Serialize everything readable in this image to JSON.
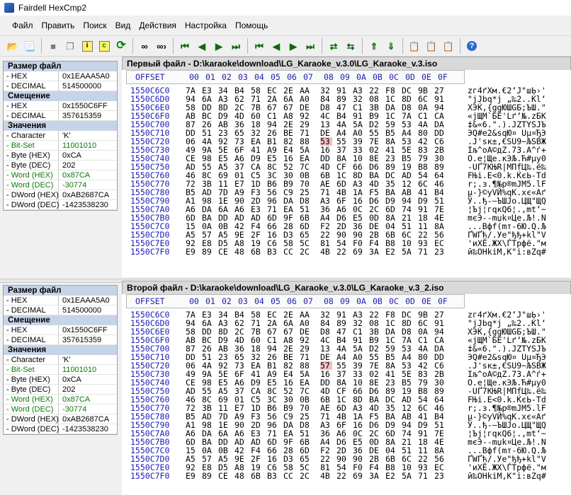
{
  "app": {
    "title": "Fairdell HexCmp2"
  },
  "menu": [
    "Файл",
    "Править",
    "Поиск",
    "Вид",
    "Действия",
    "Настройка",
    "Помощь"
  ],
  "toolbar": [
    "open-file-icon",
    "open-file-2-icon",
    "stop-icon",
    "copy-icon",
    "info-icon",
    "compare-c-icon",
    "refresh-icon",
    "binoculars-icon",
    "find-next-icon",
    "first-diff-icon",
    "prev-diff-icon",
    "next-diff-icon",
    "last-diff-icon",
    "first-diff-2-icon",
    "prev-diff-2-icon",
    "next-diff-2-icon",
    "last-diff-2-icon",
    "sync-left-icon",
    "sync-right-icon",
    "align-up-icon",
    "align-down-icon",
    "report-icon",
    "report-disabled-icon",
    "report-disabled-2-icon",
    "help-icon"
  ],
  "left_panel": {
    "rows": [
      {
        "kind": "head",
        "label": "Размер файл"
      },
      {
        "kind": "row",
        "key": "- HEX",
        "value": "0x1EAAA5A0"
      },
      {
        "kind": "row",
        "key": "- DECIMAL",
        "value": "514500000"
      },
      {
        "kind": "head",
        "label": "Смещение"
      },
      {
        "kind": "row",
        "key": "- HEX",
        "value": "0x1550C6FF"
      },
      {
        "kind": "row",
        "key": "- DECIMAL",
        "value": "357615359"
      },
      {
        "kind": "head",
        "label": "Значения"
      },
      {
        "kind": "row",
        "key": "- Character",
        "value": "'K'"
      },
      {
        "kind": "green",
        "key": "- Bit-Set",
        "value": "11001010"
      },
      {
        "kind": "row",
        "key": "- Byte (HEX)",
        "value": "0xCA"
      },
      {
        "kind": "row",
        "key": "- Byte (DEC)",
        "value": "202"
      },
      {
        "kind": "green",
        "key": "- Word (HEX)",
        "value": "0x87CA"
      },
      {
        "kind": "green",
        "key": "- Word (DEC)",
        "value": "-30774"
      },
      {
        "kind": "row",
        "key": "- DWord (HEX)",
        "value": "0xAB2687CA"
      },
      {
        "kind": "row",
        "key": "- DWord (DEC)",
        "value": "-1423538230"
      }
    ]
  },
  "panels": [
    {
      "title": "Первый файл - D:\\karaoke\\download\\LG_Karaoke_v.3.0\\LG_Karaoke_v.3.iso",
      "diff_byte": "53"
    },
    {
      "title": "Второй файл - D:\\karaoke\\download\\LG_Karaoke_v.3.0\\LG_Karaoke_v.3_2.iso",
      "diff_byte": "57"
    }
  ],
  "header": {
    "offset": "OFFSET",
    "cols": [
      "00",
      "01",
      "02",
      "03",
      "04",
      "05",
      "06",
      "07",
      "08",
      "09",
      "0A",
      "0B",
      "0C",
      "0D",
      "0E",
      "0F"
    ]
  },
  "rows": [
    {
      "addr": "1550C6C0",
      "bytes": "7A E3 34 B4 58 EC 2E AA 32 91 A3 22 F8 DC 9B 27",
      "ascii": "zг4ґXм.€2‘Ј\"шЬ›'"
    },
    {
      "addr": "1550C6D0",
      "bytes": "94 6A A3 62 71 2A 6A A0 84 89 32 08 1C 8D 6C 91",
      "ascii": "\"jЈbq*j „‰2..Ќl‘"
    },
    {
      "addr": "1550C6E0",
      "bytes": "58 DD 8D 2C 7B 67 67 DE D8 47 C1 3B DA D8 0A 94",
      "ascii": "XЭЌ,{ggЮШGБ;ЪШ.\""
    },
    {
      "addr": "1550C6F0",
      "bytes": "AB BC D9 4D 60 C1 A8 92 4C B4 91 B9 1C 7A C1 CA",
      "ascii": "«јЩM`БЁ'Lґ‘№.zБК"
    },
    {
      "addr": "1550C700",
      "bytes": "87 26 AB 36 18 94 2E 29 13 4A 5A D2 59 53 4A DA",
      "ascii": "‡&«6.\".).JZТYSJЪ"
    },
    {
      "addr": "1550C710",
      "bytes": "DD 51 23 65 32 26 BE 71 DE A4 A0 55 B5 A4 80 DD",
      "ascii": "ЭQ#e2&sqЮ¤ Uµ¤ЂЭ"
    },
    {
      "addr": "1550C720",
      "bytes": "06 4A 92 73 EA B1 82 88 53 55 39 7E 8A 53 42 C6",
      "ascii": ".J'sк±‚€SU9~ЉSBЖ"
    },
    {
      "addr": "1550C730",
      "bytes": "49 9A 5E 6F 41 A9 E4 5A 16 37 33 02 41 5E 83 2B",
      "ascii": "Iљ^oA©дZ.73.A^ѓ+"
    },
    {
      "addr": "1550C740",
      "bytes": "CE 98 E5 A6 D9 E5 16 EA DD 8A 10 8E 23 B5 79 30",
      "ascii": "О.е¦Ще.кЭЉ.Ћ#µy0"
    },
    {
      "addr": "1550C750",
      "bytes": "AD 55 A5 37 CA 8C 52 7C 4D CF 66 D6 89 19 B8 89",
      "ascii": "-UҐ7КЊR|MПfЦ‰.ё‰"
    },
    {
      "addr": "1550C760",
      "bytes": "46 8C 69 01 C5 3C 30 0B 6B 1C 8D BA DC AD 54 64",
      "ascii": "FЊi.Е<0.k.ЌєЬ-Td"
    },
    {
      "addr": "1550C770",
      "bytes": "72 3B 11 E7 1D B6 B9 70 AE 6D A3 4D 35 12 6C 46",
      "ascii": "r;.з.¶№p®mЈM5.lF"
    },
    {
      "addr": "1550C780",
      "bytes": "B5 AD 7D A9 F3 56 C9 25 71 4B 1A F5 BA AB 41 B4",
      "ascii": "µ-}©уVЙ%qK.хє«Aґ"
    },
    {
      "addr": "1550C790",
      "bytes": "A1 98 1E 90 2D 96 DA D8 A3 6F 16 D6 D9 94 D9 51",
      "ascii": "Ў..ђ-–ЪШЈo.ЦЩ\"ЩQ"
    },
    {
      "addr": "1550C7A0",
      "bytes": "A6 DA 6A A6 E3 71 EA 51 36 A6 0C 2C 6D 74 91 7E",
      "ascii": "¦Ъj¦гqкQ6¦.,mt‘~"
    },
    {
      "addr": "1550C7B0",
      "bytes": "6D BA DD AD AD 6D 9F 6B A4 D6 E5 0D 8A 21 18 4E",
      "ascii": "mєЭ--mџk¤Це.Љ!.N"
    },
    {
      "addr": "1550C7C0",
      "bytes": "15 0A 0B 42 F4 66 28 6D F2 2D 36 DE 04 51 11 8A",
      "ascii": "...Bфf(mт-6Ю.Q.Љ"
    },
    {
      "addr": "1550C7D0",
      "bytes": "A5 57 A5 9E 2F 16 D3 65 22 90 90 2B 6B 6C 22 56",
      "ascii": "ҐWҐћ/.Уe\"ђђ+kl\"V"
    },
    {
      "addr": "1550C7E0",
      "bytes": "92 E8 D5 A8 19 C6 58 5C 81 54 F0 F4 B8 10 93 EC",
      "ascii": "'иХЁ.ЖX\\ЃTрфё.\"м"
    },
    {
      "addr": "1550C7F0",
      "bytes": "E9 89 CE 48 6B B3 CC 2C 4B 22 69 3A E2 5A 71 23",
      "ascii": "й‰ОHkіМ,K\"i:вZq#"
    }
  ]
}
